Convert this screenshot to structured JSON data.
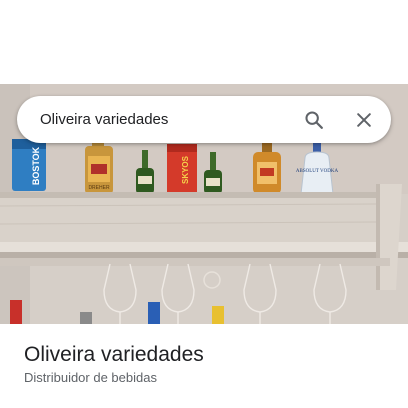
{
  "search": {
    "query": "Oliveira variedades"
  },
  "place": {
    "name": "Oliveira variedades",
    "category": "Distribuidor de bebidas"
  },
  "photo": {
    "bottle_labels": {
      "blue_bottle": "BOSTOK",
      "gold_bottle": "DREHER",
      "red_bottle": "SKYOS",
      "vodka_bottle": "ABSOLUT VODKA"
    }
  },
  "icons": {
    "search": "search-icon",
    "clear": "close-icon"
  },
  "colors": {
    "icon": "#5f6368",
    "title": "#202124",
    "subtitle": "#5f6368"
  }
}
